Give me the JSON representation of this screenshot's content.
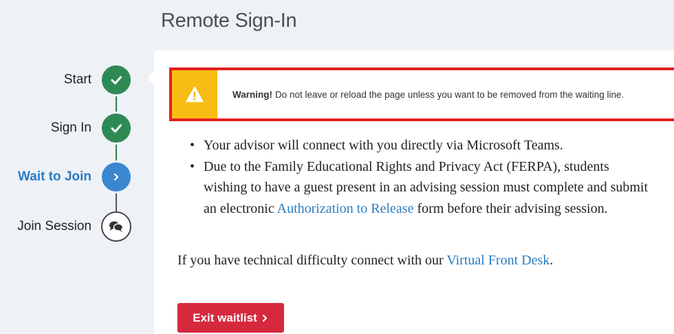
{
  "page": {
    "title": "Remote Sign-In"
  },
  "stepper": {
    "steps": [
      {
        "label": "Start",
        "state": "done",
        "icon": "check-icon"
      },
      {
        "label": "Sign In",
        "state": "done",
        "icon": "check-icon"
      },
      {
        "label": "Wait to Join",
        "state": "current",
        "icon": "chevron-right-icon"
      },
      {
        "label": "Join Session",
        "state": "pending",
        "icon": "chat-bubbles-icon"
      }
    ]
  },
  "warning": {
    "icon": "warning-triangle-icon",
    "strong": "Warning!",
    "text": "Do not leave or reload the page unless you want to be removed from the waiting line."
  },
  "info": {
    "bullet1": "Your advisor will connect with you directly via Microsoft Teams.",
    "bullet2_pre": "Due to the Family Educational Rights and Privacy Act (FERPA), students wishing to have a guest present in an advising session must complete and submit an electronic ",
    "bullet2_link": "Authorization to Release",
    "bullet2_post": " form before their advising session.",
    "tech_pre": "If you have technical difficulty connect with our ",
    "tech_link": "Virtual Front Desk",
    "tech_post": "."
  },
  "actions": {
    "exit_label": "Exit waitlist",
    "exit_icon": "chevron-right-icon"
  },
  "colors": {
    "done": "#2e8a55",
    "current": "#3a86cf",
    "warning": "#f7bd14",
    "highlight_border": "#e41e1e",
    "danger": "#d6293e",
    "link": "#2a7cc2"
  }
}
